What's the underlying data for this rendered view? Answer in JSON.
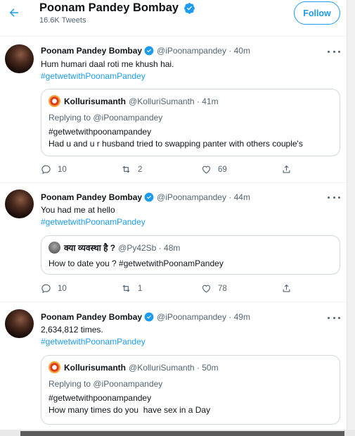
{
  "header": {
    "title": "Poonam Pandey Bombay",
    "tweet_count": "16.6K Tweets",
    "follow_label": "Follow"
  },
  "tweets": [
    {
      "name": "Poonam Pandey Bombay",
      "handle_time": "@iPoonampandey · 40m",
      "lines": [
        "Hum humari daal roti me khush hai."
      ],
      "hashtag": "#getwetwithPoonamPandey",
      "quote": {
        "name": "Kollurisumanth",
        "handle_time": "@KolluriSumanth · 41m",
        "replying": "Replying to @iPoonampandey",
        "lines": [
          "#getwetwithpoonampandey",
          "Had u and u r husband tried to swapping panter with others couple's"
        ]
      },
      "replies": "10",
      "retweets": "2",
      "likes": "69"
    },
    {
      "name": "Poonam Pandey Bombay",
      "handle_time": "@iPoonampandey · 44m",
      "lines": [
        "You had me at hello"
      ],
      "hashtag": "#getwetwithPoonamPandey",
      "quote": {
        "name": "क्या व्यवस्था है ?",
        "handle_time": "@Py42Sb · 48m",
        "lines": [
          "How to date you ?  #getwetwithPoonamPandey"
        ]
      },
      "replies": "10",
      "retweets": "1",
      "likes": "78"
    },
    {
      "name": "Poonam Pandey Bombay",
      "handle_time": "@iPoonampandey · 49m",
      "lines": [
        "2,634,812 times."
      ],
      "hashtag": "#getwetwithPoonamPandey",
      "quote": {
        "name": "Kollurisumanth",
        "handle_time": "@KolluriSumanth · 50m",
        "replying": "Replying to @iPoonampandey",
        "lines": [
          "#getwetwithpoonampandey",
          "How many times do you  have sex in a Day"
        ]
      }
    }
  ],
  "colors": {
    "accent": "#1d9bf0",
    "secondary_text": "#536471",
    "border": "#cfd9de"
  }
}
